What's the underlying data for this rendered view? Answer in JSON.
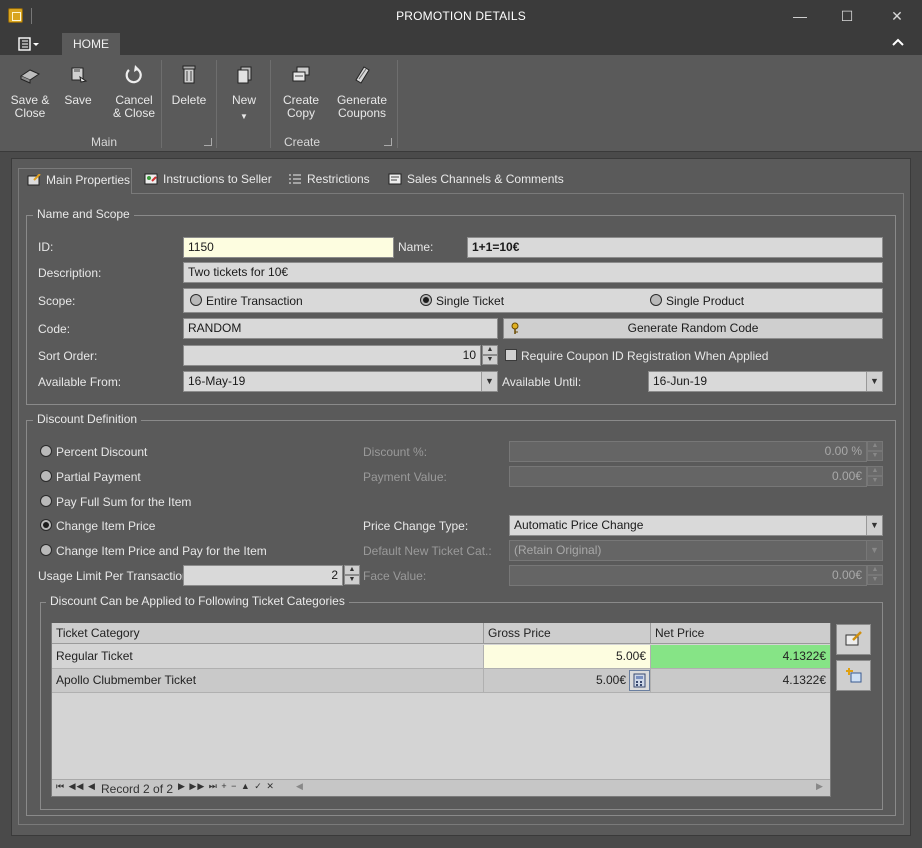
{
  "window": {
    "title": "PROMOTION DETAILS",
    "minimize": "—",
    "maximize": "☐",
    "close": "✕"
  },
  "ribbon": {
    "tab": "HOME",
    "buttons": {
      "save_close": "Save &\nClose",
      "save": "Save",
      "cancel_close": "Cancel\n& Close",
      "delete": "Delete",
      "new": "New",
      "create_copy": "Create\nCopy",
      "generate_coupons": "Generate\nCoupons"
    },
    "groups": {
      "main": "Main",
      "create": "Create"
    }
  },
  "tabs": [
    "Main Properties",
    "Instructions to Seller",
    "Restrictions",
    "Sales Channels & Comments"
  ],
  "name_scope": {
    "title": "Name and Scope",
    "id_label": "ID:",
    "id": "1150",
    "name_label": "Name:",
    "name": "1+1=10€",
    "desc_label": "Description:",
    "description": "Two tickets for 10€",
    "scope_label": "Scope:",
    "scope_options": [
      "Entire Transaction",
      "Single Ticket",
      "Single Product"
    ],
    "code_label": "Code:",
    "code": "RANDOM",
    "generate_code": "Generate Random Code",
    "sort_label": "Sort Order:",
    "sort": "10",
    "require_coupon": "Require Coupon ID Registration When Applied",
    "from_label": "Available From:",
    "from": "16-May-19",
    "until_label": "Available Until:",
    "until": "16-Jun-19"
  },
  "discount": {
    "title": "Discount Definition",
    "options": [
      "Percent Discount",
      "Partial Payment",
      "Pay Full Sum for the Item",
      "Change Item Price",
      "Change Item Price and Pay for the Item"
    ],
    "discount_pct_label": "Discount %:",
    "discount_pct": "0.00 %",
    "payment_value_label": "Payment Value:",
    "payment_value": "0.00€",
    "price_change_label": "Price Change Type:",
    "price_change": "Automatic Price Change",
    "default_cat_label": "Default New Ticket Cat.:",
    "default_cat": "(Retain Original)",
    "usage_label": "Usage Limit Per Transaction:",
    "usage": "2",
    "face_label": "Face Value:",
    "face": "0.00€"
  },
  "categories": {
    "title": "Discount Can be Applied to Following Ticket Categories",
    "columns": [
      "Ticket Category",
      "Gross Price",
      "Net Price"
    ],
    "rows": [
      {
        "category": "Regular Ticket",
        "gross": "5.00€",
        "net": "4.1322€"
      },
      {
        "category": "Apollo Clubmember Ticket",
        "gross": "5.00€",
        "net": "4.1322€"
      }
    ],
    "record_text": "Record 2 of 2"
  },
  "colors": {
    "highlight_green": "#86e486",
    "highlight_yellow": "#fdfde0"
  }
}
